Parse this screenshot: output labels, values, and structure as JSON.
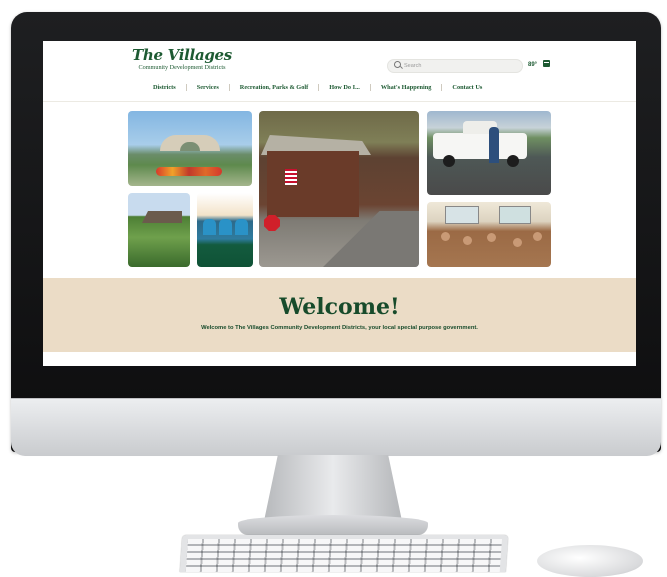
{
  "site": {
    "logo_main": "The Villages",
    "logo_sub": "Community Development Districts"
  },
  "header": {
    "search_placeholder": "Search",
    "temperature": "89°"
  },
  "nav": {
    "items": [
      {
        "label": "Districts"
      },
      {
        "label": "Services"
      },
      {
        "label": "Recreation, Parks & Golf"
      },
      {
        "label": "How Do I..."
      },
      {
        "label": "What's Happening"
      },
      {
        "label": "Contact Us"
      }
    ]
  },
  "welcome": {
    "title": "Welcome!",
    "subtitle": "Welcome to The Villages Community Development Districts, your local special purpose government."
  },
  "colors": {
    "brand_green": "#1d5a32",
    "welcome_band": "#ebdcc6"
  },
  "icons": [
    "search-icon",
    "calendar-icon"
  ]
}
